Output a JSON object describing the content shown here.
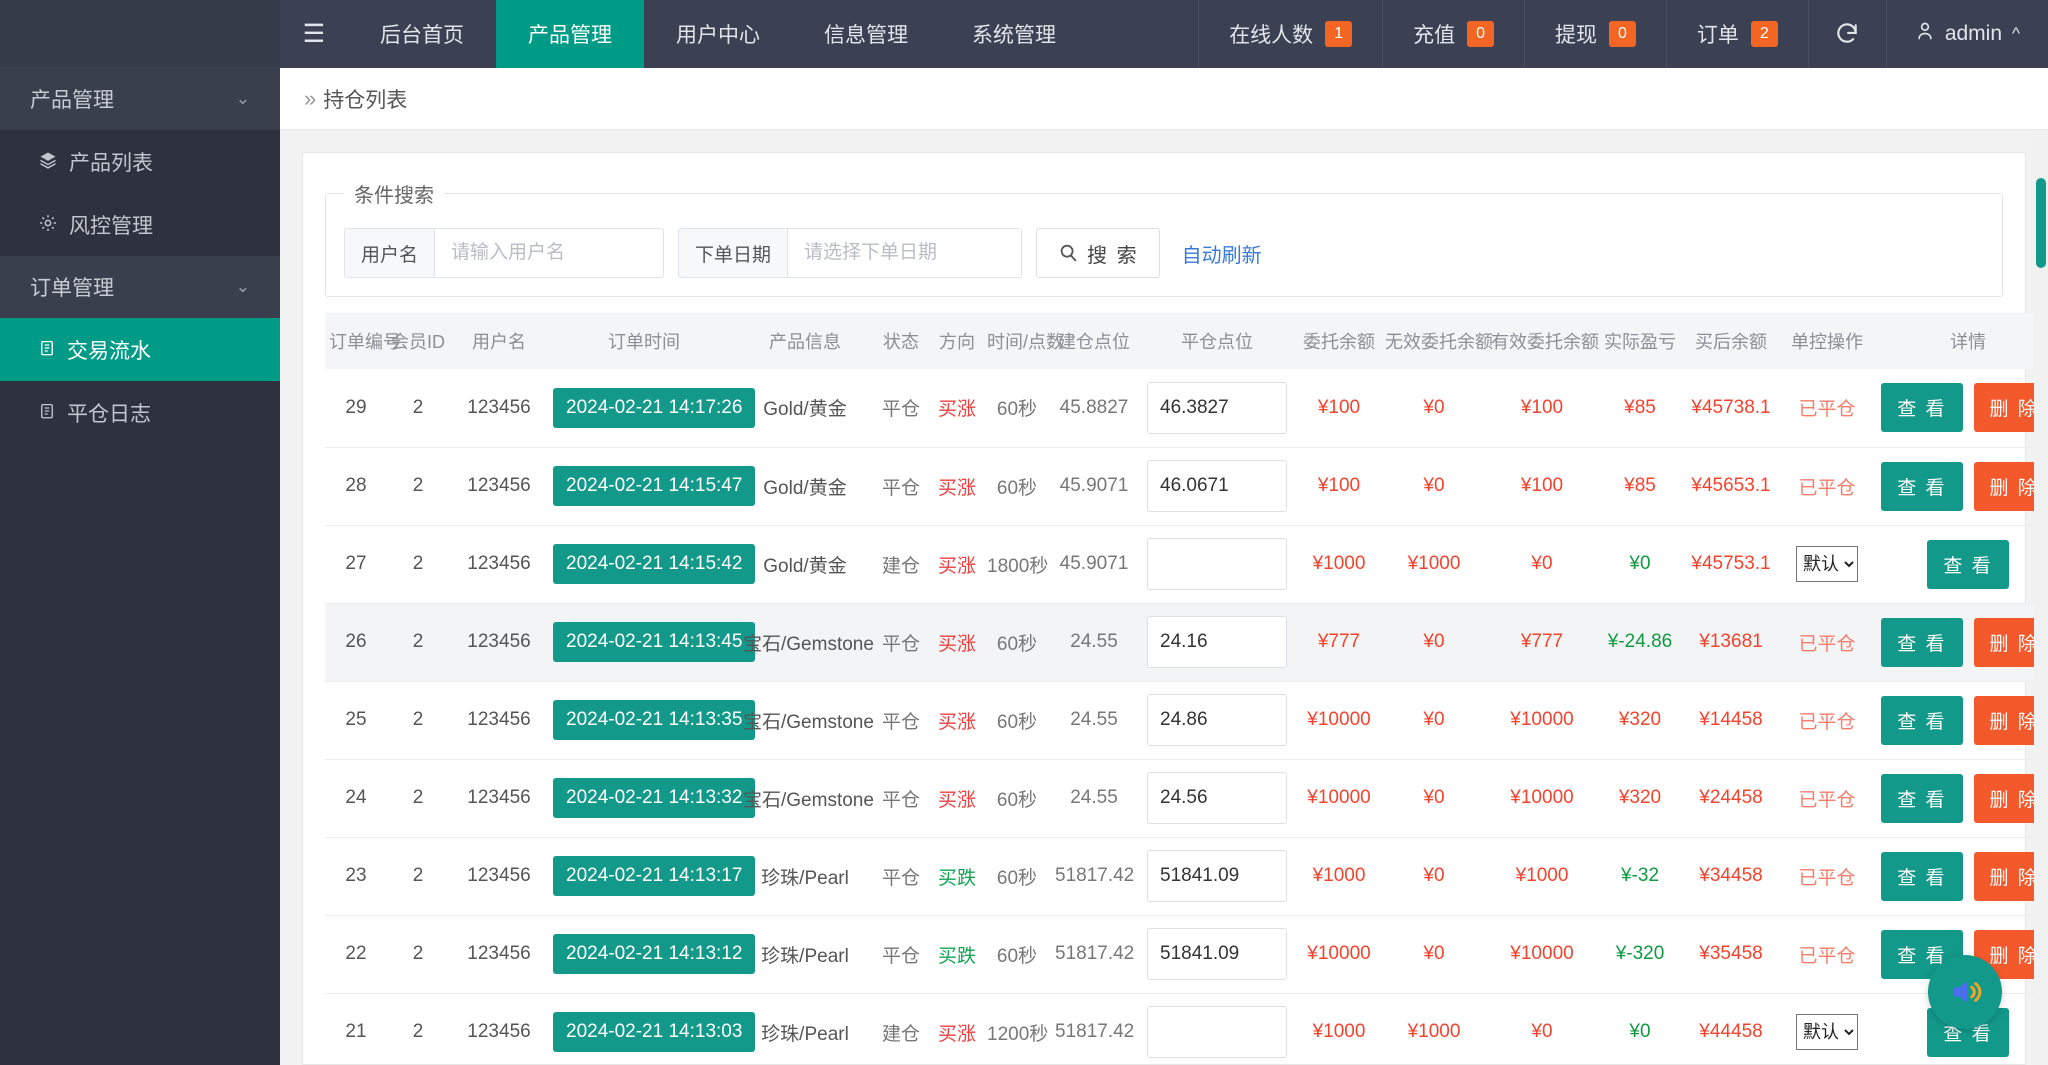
{
  "topbar": {
    "hamburger_icon": "menu-icon",
    "tabs": [
      {
        "label": "后台首页",
        "active": false
      },
      {
        "label": "产品管理",
        "active": true
      },
      {
        "label": "用户中心",
        "active": false
      },
      {
        "label": "信息管理",
        "active": false
      },
      {
        "label": "系统管理",
        "active": false
      }
    ],
    "stats": [
      {
        "label": "在线人数",
        "count": "1"
      },
      {
        "label": "充值",
        "count": "0"
      },
      {
        "label": "提现",
        "count": "0"
      },
      {
        "label": "订单",
        "count": "2"
      }
    ],
    "refresh_icon": "refresh-icon",
    "user": "admin",
    "user_icon": "user-icon",
    "user_chevron": "chevron-up-icon",
    "badge_color": "#f26522",
    "accent_color": "#009b86"
  },
  "sidebar": {
    "groups": [
      {
        "title": "产品管理",
        "chevron": "chevron-down-icon",
        "items": [
          {
            "label": "产品列表",
            "icon": "layers-icon",
            "active": false
          },
          {
            "label": "风控管理",
            "icon": "gear-icon",
            "active": false
          }
        ]
      },
      {
        "title": "订单管理",
        "chevron": "chevron-down-icon",
        "items": [
          {
            "label": "交易流水",
            "icon": "clipboard-icon",
            "active": true
          },
          {
            "label": "平仓日志",
            "icon": "clipboard-icon",
            "active": false
          }
        ]
      }
    ]
  },
  "breadcrumb": {
    "marker": "»",
    "title": "持仓列表"
  },
  "search": {
    "legend": "条件搜索",
    "username_label": "用户名",
    "username_placeholder": "请输入用户名",
    "username_value": "",
    "date_label": "下单日期",
    "date_placeholder": "请选择下单日期",
    "date_value": "",
    "search_button": "搜 索",
    "search_icon": "search-icon",
    "auto_refresh_link": "自动刷新"
  },
  "table": {
    "headers": [
      "订单编号",
      "会员ID",
      "用户名",
      "订单时间",
      "产品信息",
      "状态",
      "方向",
      "时间/点数",
      "建仓点位",
      "平仓点位",
      "委托余额",
      "无效委托余额",
      "有效委托余额",
      "实际盈亏",
      "买后余额",
      "单控操作",
      "详情"
    ],
    "view_label": "查 看",
    "delete_label": "删 除",
    "select_default": "默认",
    "rows": [
      {
        "id": "29",
        "member_id": "2",
        "username": "123456",
        "time": "2024-02-21 14:17:26",
        "product": "Gold/黄金",
        "state": "平仓",
        "direction": "买涨",
        "dir_kind": "up",
        "duration": "60秒",
        "open_point": "45.8827",
        "close_point": "46.3827",
        "entrust": "¥100",
        "invalid_entrust": "¥0",
        "valid_entrust": "¥100",
        "pl": "¥85",
        "pl_kind": "red",
        "balance": "¥45738.1",
        "control": "已平仓",
        "control_kind": "text",
        "has_delete": true,
        "alt": false
      },
      {
        "id": "28",
        "member_id": "2",
        "username": "123456",
        "time": "2024-02-21 14:15:47",
        "product": "Gold/黄金",
        "state": "平仓",
        "direction": "买涨",
        "dir_kind": "up",
        "duration": "60秒",
        "open_point": "45.9071",
        "close_point": "46.0671",
        "entrust": "¥100",
        "invalid_entrust": "¥0",
        "valid_entrust": "¥100",
        "pl": "¥85",
        "pl_kind": "red",
        "balance": "¥45653.1",
        "control": "已平仓",
        "control_kind": "text",
        "has_delete": true,
        "alt": false
      },
      {
        "id": "27",
        "member_id": "2",
        "username": "123456",
        "time": "2024-02-21 14:15:42",
        "product": "Gold/黄金",
        "state": "建仓",
        "direction": "买涨",
        "dir_kind": "up",
        "duration": "1800秒",
        "open_point": "45.9071",
        "close_point": "",
        "entrust": "¥1000",
        "invalid_entrust": "¥1000",
        "valid_entrust": "¥0",
        "pl": "¥0",
        "pl_kind": "green",
        "balance": "¥45753.1",
        "control": "默认",
        "control_kind": "select",
        "has_delete": false,
        "alt": false
      },
      {
        "id": "26",
        "member_id": "2",
        "username": "123456",
        "time": "2024-02-21 14:13:45",
        "product": "宝石/Gemstone",
        "state": "平仓",
        "direction": "买涨",
        "dir_kind": "up",
        "duration": "60秒",
        "open_point": "24.55",
        "close_point": "24.16",
        "entrust": "¥777",
        "invalid_entrust": "¥0",
        "valid_entrust": "¥777",
        "pl": "¥-24.86",
        "pl_kind": "green",
        "balance": "¥13681",
        "control": "已平仓",
        "control_kind": "text",
        "has_delete": true,
        "alt": true
      },
      {
        "id": "25",
        "member_id": "2",
        "username": "123456",
        "time": "2024-02-21 14:13:35",
        "product": "宝石/Gemstone",
        "state": "平仓",
        "direction": "买涨",
        "dir_kind": "up",
        "duration": "60秒",
        "open_point": "24.55",
        "close_point": "24.86",
        "entrust": "¥10000",
        "invalid_entrust": "¥0",
        "valid_entrust": "¥10000",
        "pl": "¥320",
        "pl_kind": "red",
        "balance": "¥14458",
        "control": "已平仓",
        "control_kind": "text",
        "has_delete": true,
        "alt": false
      },
      {
        "id": "24",
        "member_id": "2",
        "username": "123456",
        "time": "2024-02-21 14:13:32",
        "product": "宝石/Gemstone",
        "state": "平仓",
        "direction": "买涨",
        "dir_kind": "up",
        "duration": "60秒",
        "open_point": "24.55",
        "close_point": "24.56",
        "entrust": "¥10000",
        "invalid_entrust": "¥0",
        "valid_entrust": "¥10000",
        "pl": "¥320",
        "pl_kind": "red",
        "balance": "¥24458",
        "control": "已平仓",
        "control_kind": "text",
        "has_delete": true,
        "alt": false
      },
      {
        "id": "23",
        "member_id": "2",
        "username": "123456",
        "time": "2024-02-21 14:13:17",
        "product": "珍珠/Pearl",
        "state": "平仓",
        "direction": "买跌",
        "dir_kind": "down",
        "duration": "60秒",
        "open_point": "51817.42",
        "close_point": "51841.09",
        "entrust": "¥1000",
        "invalid_entrust": "¥0",
        "valid_entrust": "¥1000",
        "pl": "¥-32",
        "pl_kind": "green",
        "balance": "¥34458",
        "control": "已平仓",
        "control_kind": "text",
        "has_delete": true,
        "alt": false
      },
      {
        "id": "22",
        "member_id": "2",
        "username": "123456",
        "time": "2024-02-21 14:13:12",
        "product": "珍珠/Pearl",
        "state": "平仓",
        "direction": "买跌",
        "dir_kind": "down",
        "duration": "60秒",
        "open_point": "51817.42",
        "close_point": "51841.09",
        "entrust": "¥10000",
        "invalid_entrust": "¥0",
        "valid_entrust": "¥10000",
        "pl": "¥-320",
        "pl_kind": "green",
        "balance": "¥35458",
        "control": "已平仓",
        "control_kind": "text",
        "has_delete": true,
        "alt": false
      },
      {
        "id": "21",
        "member_id": "2",
        "username": "123456",
        "time": "2024-02-21 14:13:03",
        "product": "珍珠/Pearl",
        "state": "建仓",
        "direction": "买涨",
        "dir_kind": "up",
        "duration": "1200秒",
        "open_point": "51817.42",
        "close_point": "",
        "entrust": "¥1000",
        "invalid_entrust": "¥1000",
        "valid_entrust": "¥0",
        "pl": "¥0",
        "pl_kind": "green",
        "balance": "¥44458",
        "control": "默认",
        "control_kind": "select",
        "has_delete": false,
        "alt": false
      }
    ]
  },
  "fab": {
    "icon": "speaker-sound-icon"
  }
}
